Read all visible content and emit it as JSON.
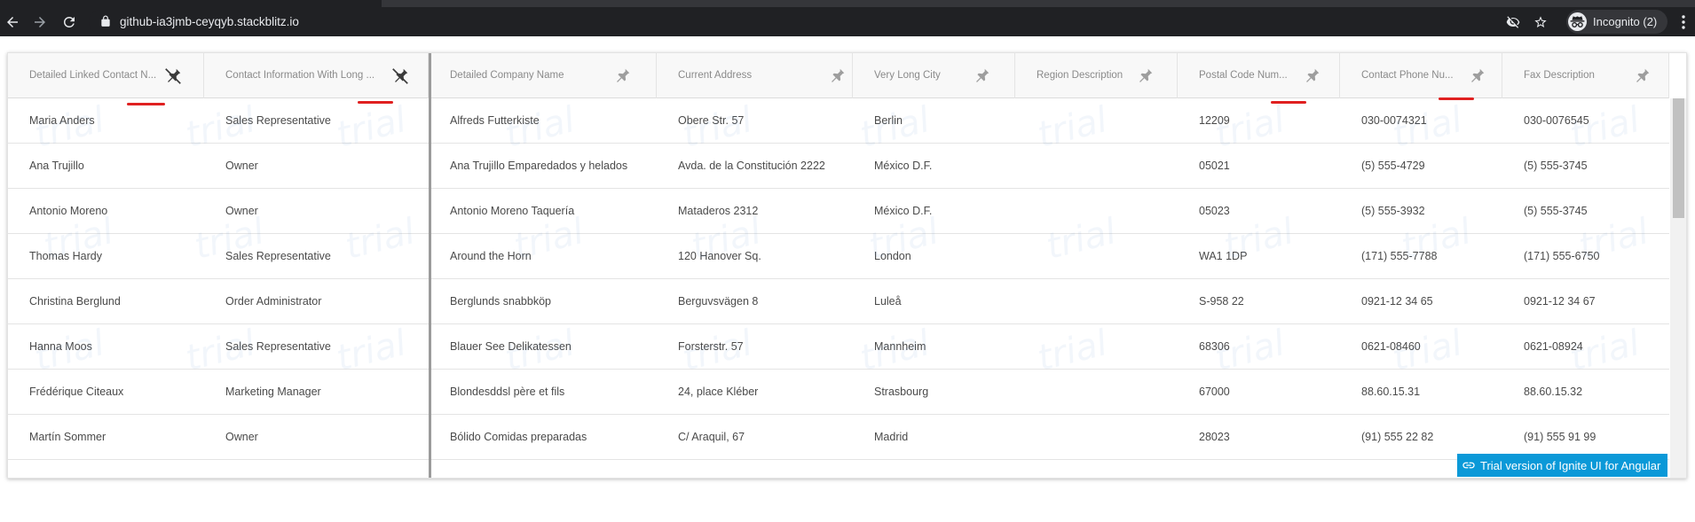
{
  "browser": {
    "url": "github-ia3jmb-ceyqyb.stackblitz.io",
    "incognito_label": "Incognito (2)",
    "icons": [
      "back-arrow-icon",
      "forward-arrow-icon",
      "reload-icon",
      "lock-icon",
      "eye-off-icon",
      "star-icon",
      "incognito-icon",
      "kebab-menu-icon"
    ]
  },
  "grid": {
    "columns": [
      {
        "title": "Detailed Linked Contact N...",
        "pinned": true
      },
      {
        "title": "Contact Information With Long ...",
        "pinned": true
      },
      {
        "title": "Detailed Company Name",
        "pinned": false
      },
      {
        "title": "Current Address",
        "pinned": false
      },
      {
        "title": "Very Long City",
        "pinned": false
      },
      {
        "title": "Region Description",
        "pinned": false
      },
      {
        "title": "Postal Code Num...",
        "pinned": false
      },
      {
        "title": "Contact Phone Nu...",
        "pinned": false
      },
      {
        "title": "Fax Description",
        "pinned": false
      }
    ],
    "rows": [
      [
        "Maria Anders",
        "Sales Representative",
        "Alfreds Futterkiste",
        "Obere Str. 57",
        "Berlin",
        "",
        "12209",
        "030-0074321",
        "030-0076545"
      ],
      [
        "Ana Trujillo",
        "Owner",
        "Ana Trujillo Emparedados y helados",
        "Avda. de la Constitución 2222",
        "México D.F.",
        "",
        "05021",
        "(5) 555-4729",
        "(5) 555-3745"
      ],
      [
        "Antonio Moreno",
        "Owner",
        "Antonio Moreno Taquería",
        "Mataderos 2312",
        "México D.F.",
        "",
        "05023",
        "(5) 555-3932",
        "(5) 555-3745"
      ],
      [
        "Thomas Hardy",
        "Sales Representative",
        "Around the Horn",
        "120 Hanover Sq.",
        "London",
        "",
        "WA1 1DP",
        "(171) 555-7788",
        "(171) 555-6750"
      ],
      [
        "Christina Berglund",
        "Order Administrator",
        "Berglunds snabbköp",
        "Berguvsvägen 8",
        "Luleå",
        "",
        "S-958 22",
        "0921-12 34 65",
        "0921-12 34 67"
      ],
      [
        "Hanna Moos",
        "Sales Representative",
        "Blauer See Delikatessen",
        "Forsterstr. 57",
        "Mannheim",
        "",
        "68306",
        "0621-08460",
        "0621-08924"
      ],
      [
        "Frédérique Citeaux",
        "Marketing Manager",
        "Blondesddsl père et fils",
        "24, place Kléber",
        "Strasbourg",
        "",
        "67000",
        "88.60.15.31",
        "88.60.15.32"
      ],
      [
        "Martín Sommer",
        "Owner",
        "Bólido Comidas preparadas",
        "C/ Araquil, 67",
        "Madrid",
        "",
        "28023",
        "(91) 555 22 82",
        "(91) 555 91 99"
      ]
    ],
    "watermark_text": "trial",
    "trial_badge": "Trial version of Ignite UI for Angular"
  },
  "colors": {
    "chrome_bg": "#202124",
    "header_bg": "#f8f8f8",
    "trial_badge": "#0b99d8",
    "annotation_marker": "#e02020"
  }
}
